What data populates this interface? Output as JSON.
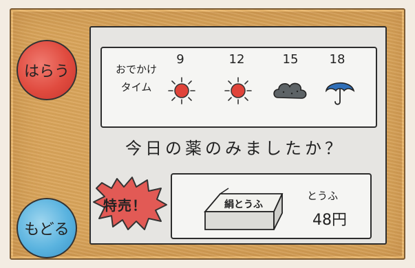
{
  "buttons": {
    "pay_label": "はらう",
    "back_label": "もどる"
  },
  "weather": {
    "label_line1": "おでかけ",
    "label_line2": "タイム",
    "slots": [
      {
        "hour": "9",
        "icon": "sun-icon"
      },
      {
        "hour": "12",
        "icon": "sun-icon"
      },
      {
        "hour": "15",
        "icon": "cloud-icon"
      },
      {
        "hour": "18",
        "icon": "umbrella-icon"
      }
    ]
  },
  "reminder": {
    "question": "今日の薬のみましたか？"
  },
  "sale": {
    "badge_label": "特売！",
    "product_box_label": "絹とうふ",
    "product_name": "とうふ",
    "price": "48円"
  },
  "colors": {
    "frame": "#d9a45a",
    "pay_button": "#e04b3f",
    "back_button": "#5ab3df",
    "sun": "#e0443a",
    "cloud": "#5d6366",
    "umbrella": "#2f6fb8",
    "sale_badge": "#e25a55"
  }
}
